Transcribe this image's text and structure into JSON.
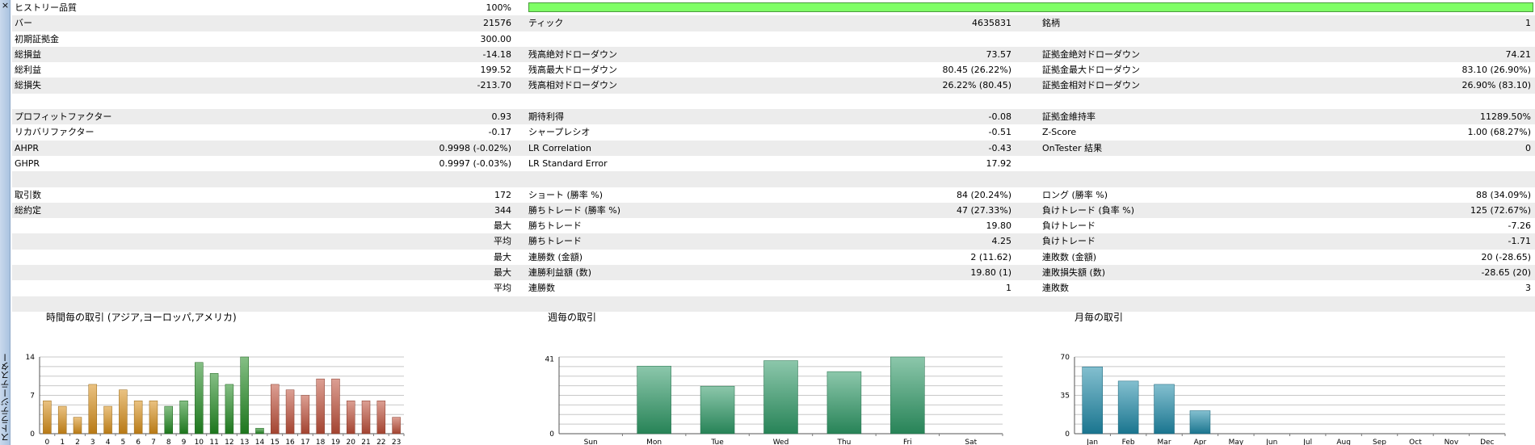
{
  "sidebar": {
    "close_glyph": "×",
    "title": "ストラテジーテスター"
  },
  "quality": {
    "label": "ヒストリー品質",
    "value": "100%",
    "fill_percent": 100,
    "color": "#7fff66"
  },
  "rows": [
    {
      "alt": true,
      "c1": [
        "バー",
        "21576"
      ],
      "c2": [
        "ティック",
        "4635831"
      ],
      "c3": [
        "銘柄",
        "1"
      ]
    },
    {
      "alt": false,
      "c1": [
        "初期証拠金",
        "300.00"
      ],
      "c2": [
        "",
        ""
      ],
      "c3": [
        "",
        ""
      ]
    },
    {
      "alt": true,
      "c1": [
        "総損益",
        "-14.18"
      ],
      "c2": [
        "残高絶対ドローダウン",
        "73.57"
      ],
      "c3": [
        "証拠金絶対ドローダウン",
        "74.21"
      ]
    },
    {
      "alt": false,
      "c1": [
        "総利益",
        "199.52"
      ],
      "c2": [
        "残高最大ドローダウン",
        "80.45 (26.22%)"
      ],
      "c3": [
        "証拠金最大ドローダウン",
        "83.10 (26.90%)"
      ]
    },
    {
      "alt": true,
      "c1": [
        "総損失",
        "-213.70"
      ],
      "c2": [
        "残高相対ドローダウン",
        "26.22% (80.45)"
      ],
      "c3": [
        "証拠金相対ドローダウン",
        "26.90% (83.10)"
      ]
    },
    {
      "alt": false,
      "c1": [
        "",
        ""
      ],
      "c2": [
        "",
        ""
      ],
      "c3": [
        "",
        ""
      ]
    },
    {
      "alt": true,
      "c1": [
        "プロフィットファクター",
        "0.93"
      ],
      "c2": [
        "期待利得",
        "-0.08"
      ],
      "c3": [
        "証拠金維持率",
        "11289.50%"
      ]
    },
    {
      "alt": false,
      "c1": [
        "リカバリファクター",
        "-0.17"
      ],
      "c2": [
        "シャープレシオ",
        "-0.51"
      ],
      "c3": [
        "Z-Score",
        "1.00 (68.27%)"
      ]
    },
    {
      "alt": true,
      "c1": [
        "AHPR",
        "0.9998 (-0.02%)"
      ],
      "c2": [
        "LR Correlation",
        "-0.43"
      ],
      "c3": [
        "OnTester 結果",
        "0"
      ]
    },
    {
      "alt": false,
      "c1": [
        "GHPR",
        "0.9997 (-0.03%)"
      ],
      "c2": [
        "LR Standard Error",
        "17.92"
      ],
      "c3": [
        "",
        ""
      ]
    },
    {
      "alt": true,
      "c1": [
        "",
        ""
      ],
      "c2": [
        "",
        ""
      ],
      "c3": [
        "",
        ""
      ]
    },
    {
      "alt": false,
      "c1": [
        "取引数",
        "172"
      ],
      "c2": [
        "ショート (勝率 %)",
        "84 (20.24%)"
      ],
      "c3": [
        "ロング (勝率 %)",
        "88 (34.09%)"
      ]
    },
    {
      "alt": true,
      "c1": [
        "総約定",
        "344"
      ],
      "c2": [
        "勝ちトレード (勝率 %)",
        "47 (27.33%)"
      ],
      "c3": [
        "負けトレード (負率 %)",
        "125 (72.67%)"
      ]
    },
    {
      "alt": false,
      "c1": [
        "",
        "最大"
      ],
      "c2": [
        "勝ちトレード",
        "19.80"
      ],
      "c3": [
        "負けトレード",
        "-7.26"
      ]
    },
    {
      "alt": true,
      "c1": [
        "",
        "平均"
      ],
      "c2": [
        "勝ちトレード",
        "4.25"
      ],
      "c3": [
        "負けトレード",
        "-1.71"
      ]
    },
    {
      "alt": false,
      "c1": [
        "",
        "最大"
      ],
      "c2": [
        "連勝数 (金額)",
        "2 (11.62)"
      ],
      "c3": [
        "連敗数 (金額)",
        "20 (-28.65)"
      ]
    },
    {
      "alt": true,
      "c1": [
        "",
        "最大"
      ],
      "c2": [
        "連勝利益額 (数)",
        "19.80 (1)"
      ],
      "c3": [
        "連敗損失額 (数)",
        "-28.65 (20)"
      ]
    },
    {
      "alt": false,
      "c1": [
        "",
        "平均"
      ],
      "c2": [
        "連勝数",
        "1"
      ],
      "c3": [
        "連敗数",
        "3"
      ]
    },
    {
      "alt": true,
      "c1": [
        "",
        ""
      ],
      "c2": [
        "",
        ""
      ],
      "c3": [
        "",
        ""
      ]
    }
  ],
  "chart_data": [
    {
      "type": "bar",
      "title": "時間毎の取引 (アジア,ヨーロッパ,アメリカ)",
      "categories": [
        "0",
        "1",
        "2",
        "3",
        "4",
        "5",
        "6",
        "7",
        "8",
        "9",
        "10",
        "11",
        "12",
        "13",
        "14",
        "15",
        "16",
        "17",
        "18",
        "19",
        "20",
        "21",
        "22",
        "23"
      ],
      "values": [
        6,
        5,
        3,
        9,
        5,
        8,
        6,
        6,
        5,
        6,
        13,
        11,
        9,
        14,
        1,
        9,
        8,
        7,
        10,
        10,
        6,
        6,
        6,
        3
      ],
      "y_ticks": [
        "0",
        "7",
        "14"
      ],
      "ylim": [
        0,
        14
      ],
      "grid": true,
      "colors": {
        "asia": "#d8901a",
        "europe": "#228b22",
        "america": "#c0503a"
      },
      "bar_color_groups": [
        "asia",
        "asia",
        "asia",
        "asia",
        "asia",
        "asia",
        "asia",
        "asia",
        "europe",
        "europe",
        "europe",
        "europe",
        "europe",
        "europe",
        "europe",
        "america",
        "america",
        "america",
        "america",
        "america",
        "america",
        "america",
        "america",
        "america"
      ]
    },
    {
      "type": "bar",
      "title": "週毎の取引",
      "categories": [
        "Sun",
        "Mon",
        "Tue",
        "Wed",
        "Thu",
        "Fri",
        "Sat"
      ],
      "values": [
        0,
        37,
        26,
        40,
        34,
        42,
        0
      ],
      "y_ticks": [
        "0",
        "41"
      ],
      "ylim": [
        0,
        42
      ],
      "grid": true,
      "color": "#2e9a66"
    },
    {
      "type": "bar",
      "title": "月毎の取引",
      "categories": [
        "Jan",
        "Feb",
        "Mar",
        "Apr",
        "May",
        "Jun",
        "Jul",
        "Aug",
        "Sep",
        "Oct",
        "Nov",
        "Dec"
      ],
      "values": [
        61,
        48,
        45,
        21,
        0,
        0,
        0,
        0,
        0,
        0,
        0,
        0
      ],
      "y_ticks": [
        "0",
        "35",
        "70"
      ],
      "ylim": [
        0,
        70
      ],
      "grid": true,
      "color": "#1e8aa8"
    }
  ]
}
